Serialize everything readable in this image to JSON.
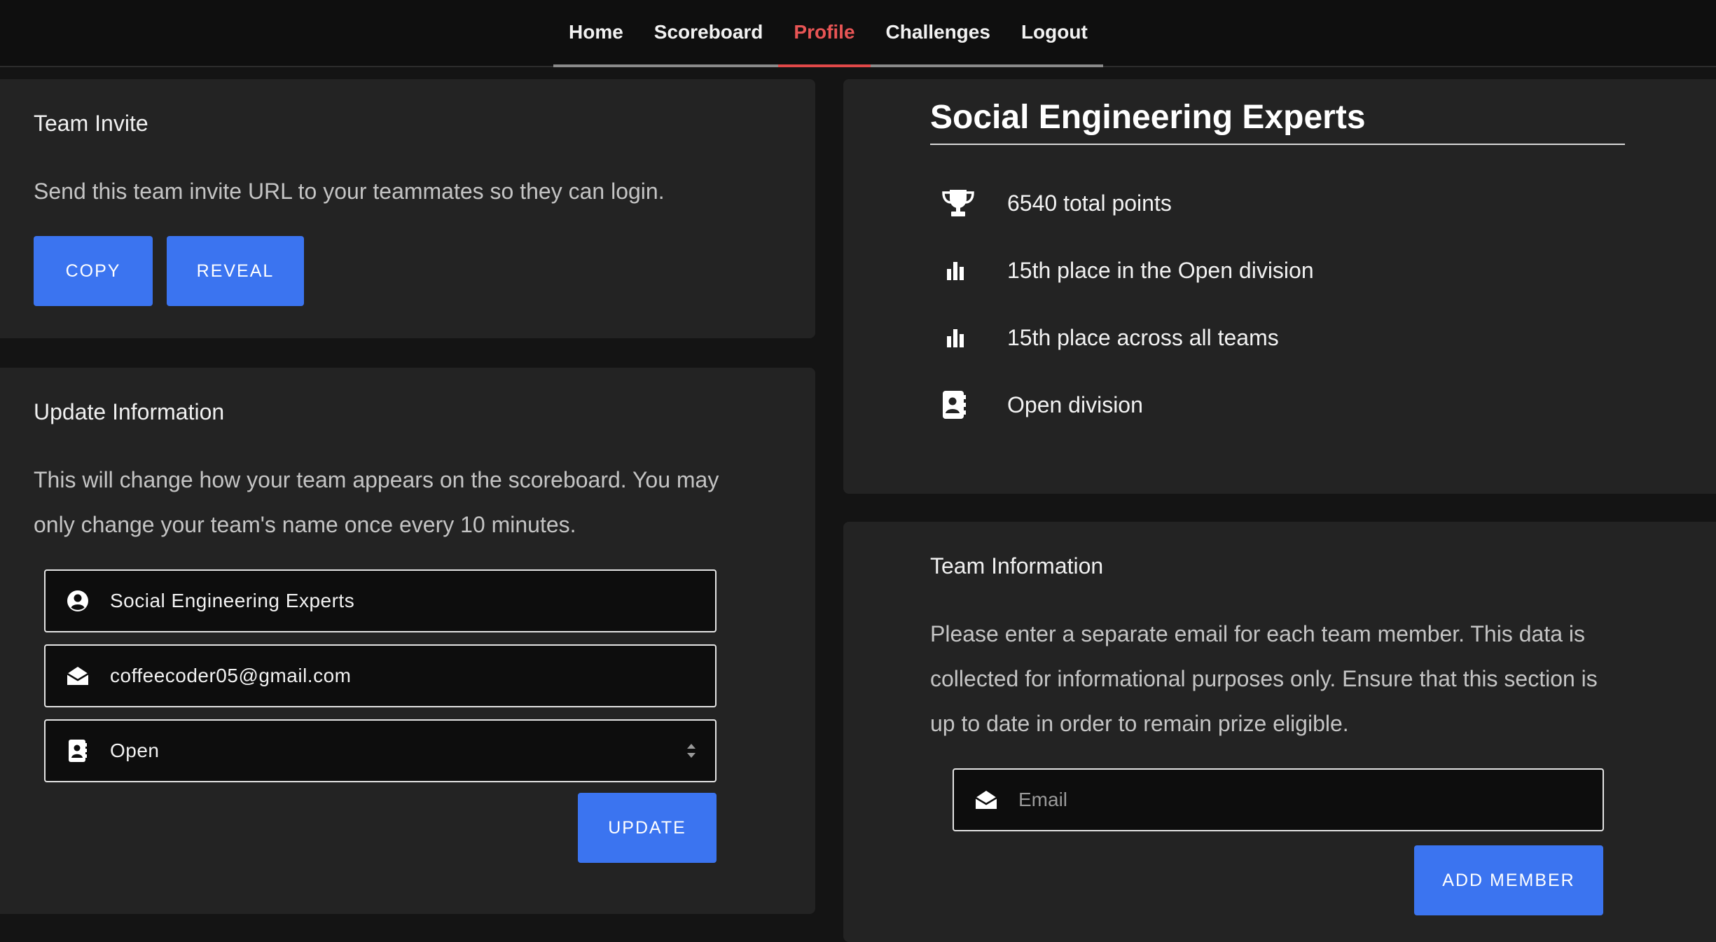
{
  "nav": {
    "items": [
      {
        "label": "Home",
        "active": false
      },
      {
        "label": "Scoreboard",
        "active": false
      },
      {
        "label": "Profile",
        "active": true
      },
      {
        "label": "Challenges",
        "active": false
      },
      {
        "label": "Logout",
        "active": false
      }
    ]
  },
  "invite": {
    "title": "Team Invite",
    "description": "Send this team invite URL to your teammates so they can login.",
    "copy_label": "COPY",
    "reveal_label": "REVEAL"
  },
  "update": {
    "title": "Update Information",
    "description_line1": "This will change how your team appears on the scoreboard. You may",
    "description_line2": "only change your team's name once every 10 minutes.",
    "team_name_value": "Social Engineering Experts",
    "email_value": "coffeecoder05@gmail.com",
    "division_value": "Open",
    "update_label": "UPDATE"
  },
  "profile": {
    "team_name": "Social Engineering Experts",
    "stats": [
      {
        "icon": "trophy-icon",
        "text": "6540 total points"
      },
      {
        "icon": "bar-chart-icon",
        "text": "15th place in the Open division"
      },
      {
        "icon": "bar-chart-icon",
        "text": "15th place across all teams"
      },
      {
        "icon": "contact-book-icon",
        "text": "Open division"
      }
    ]
  },
  "team_info": {
    "title": "Team Information",
    "description_line1": "Please enter a separate email for each team member. This data is",
    "description_line2": "collected for informational purposes only. Ensure that this section is",
    "description_line3": "up to date in order to remain prize eligible.",
    "email_placeholder": "Email",
    "add_member_label": "ADD MEMBER"
  },
  "colors": {
    "accent": "#3b74f0",
    "active_nav": "#e14848",
    "background": "#141414",
    "card": "#232323"
  }
}
